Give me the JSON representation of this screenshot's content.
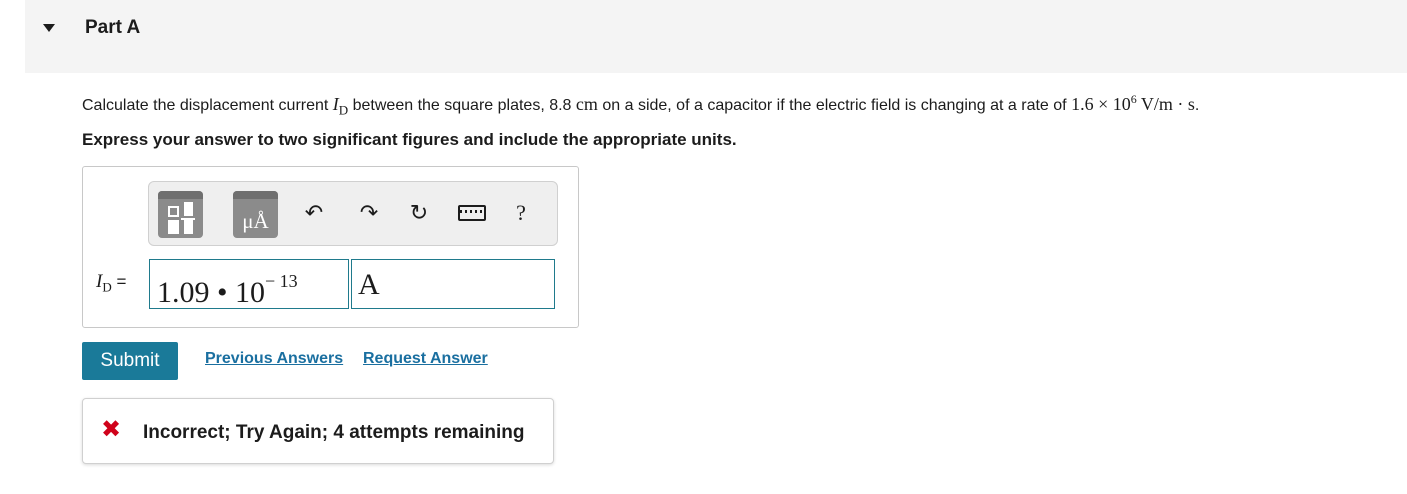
{
  "part": {
    "title": "Part A"
  },
  "question": {
    "pre": "Calculate the displacement current ",
    "symbol": "I",
    "subscript": "D",
    "mid1": " between the square plates, 8.8 ",
    "length_unit": "cm",
    "mid2": " on a side, of a capacitor if the electric field is changing at a rate of ",
    "rate_mantissa": "1.6 × 10",
    "rate_exponent": "6",
    "rate_unit": " V/m · s",
    "end": "."
  },
  "instruction": "Express your answer to two significant figures and include the appropriate units.",
  "toolbar": {
    "units_glyph": "μÅ",
    "undo_glyph": "↶",
    "redo_glyph": "↷",
    "reset_glyph": "↻",
    "help_glyph": "?"
  },
  "answer": {
    "label_symbol": "I",
    "label_subscript": "D",
    "label_eq": " =",
    "value_mantissa": "1.09 • 10",
    "value_exponent": "− 13",
    "unit": "A"
  },
  "actions": {
    "submit": "Submit",
    "previous_answers": "Previous Answers",
    "request_answer": "Request Answer"
  },
  "feedback": {
    "icon": "✖",
    "text": "Incorrect; Try Again; 4 attempts remaining",
    "color": "#d0021b"
  },
  "colors": {
    "accent": "#1a7a99",
    "link": "#1a6fa0",
    "input_border": "#1f7a8c",
    "header_bg": "#f4f4f4"
  }
}
